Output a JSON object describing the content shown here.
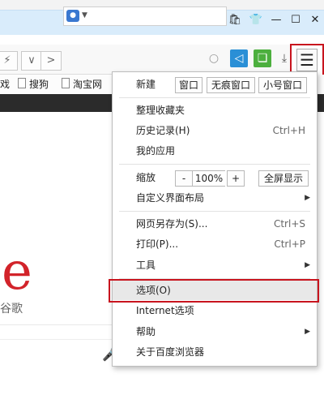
{
  "window": {
    "icons": [
      "bag-icon",
      "shirt-icon"
    ],
    "minimize": "—",
    "maximize": "☐",
    "close": "✕"
  },
  "toolbar": {
    "lightning": "⚡",
    "caret": "∨",
    "forward": ">",
    "search_glyph": "○",
    "download_glyph": "⤓",
    "menu_glyph": "☰"
  },
  "bookmarks": {
    "partial": "戏",
    "items": [
      "搜狗",
      "淘宝网"
    ]
  },
  "page": {
    "logo_letter": "e",
    "label": "谷歌"
  },
  "menu": {
    "new_label": "新建",
    "new_buttons": [
      "窗口",
      "无痕窗口",
      "小号窗口"
    ],
    "organize_favorites": "整理收藏夹",
    "history": "历史记录(H)",
    "history_shortcut": "Ctrl+H",
    "my_apps": "我的应用",
    "zoom_label": "缩放",
    "zoom_minus": "-",
    "zoom_value": "100%",
    "zoom_plus": "+",
    "fullscreen": "全屏显示",
    "customize_layout": "自定义界面布局",
    "save_as": "网页另存为(S)...",
    "save_as_shortcut": "Ctrl+S",
    "print": "打印(P)...",
    "print_shortcut": "Ctrl+P",
    "tools": "工具",
    "options": "选项(O)",
    "internet_options": "Internet选项",
    "help": "帮助",
    "about": "关于百度浏览器"
  }
}
